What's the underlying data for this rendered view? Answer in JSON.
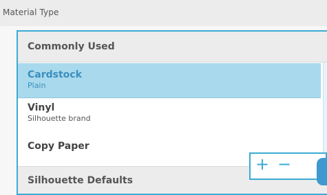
{
  "header": {
    "title": "Material Type"
  },
  "list": {
    "section_common": "Commonly Used",
    "items": [
      {
        "title": "Cardstock",
        "subtitle": "Plain",
        "selected": true
      },
      {
        "title": "Vinyl",
        "subtitle": "Silhouette brand",
        "selected": false
      },
      {
        "title": "Copy Paper",
        "subtitle": "",
        "selected": false
      }
    ],
    "section_defaults": "Silhouette Defaults"
  },
  "controls": {
    "add_label": "+",
    "remove_label": "−"
  },
  "colors": {
    "accent": "#3aaad2",
    "selected_bg": "#a9d9ec",
    "header_bg": "#ececec",
    "text": "#444444"
  }
}
